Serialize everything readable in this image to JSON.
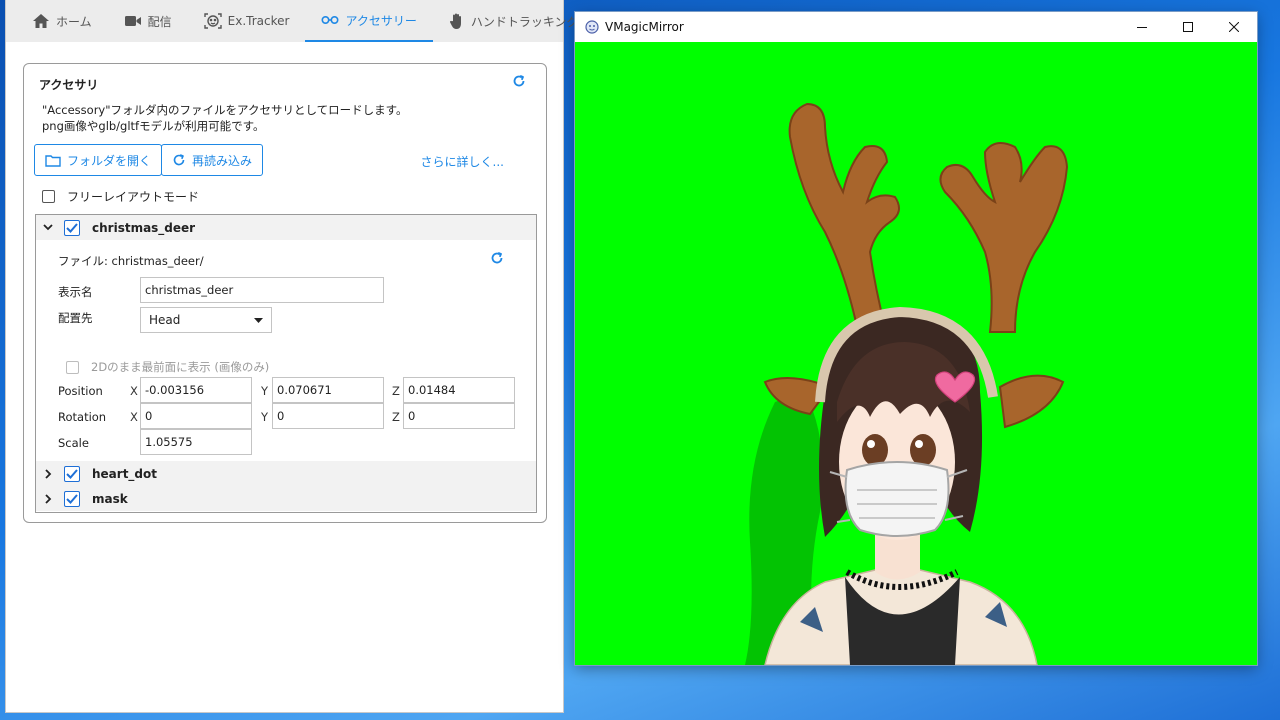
{
  "tabs": [
    {
      "label": "ホーム",
      "icon": "home-icon"
    },
    {
      "label": "配信",
      "icon": "video-camera-icon"
    },
    {
      "label": "Ex.Tracker",
      "icon": "face-tracking-icon"
    },
    {
      "label": "アクセサリー",
      "icon": "glasses-icon"
    },
    {
      "label": "ハンドトラッキング",
      "icon": "hand-icon"
    }
  ],
  "active_tab": "アクセサリー",
  "accessory": {
    "title": "アクセサリ",
    "desc_line1": "\"Accessory\"フォルダ内のファイルをアクセサリとしてロードします。",
    "desc_line2": "png画像やglb/gltfモデルが利用可能です。",
    "open_folder_label": "フォルダを開く",
    "reload_label": "再読み込み",
    "more_label": "さらに詳しく...",
    "free_layout_label": "フリーレイアウトモード",
    "free_layout_checked": false
  },
  "items": [
    {
      "name": "christmas_deer",
      "checked": true,
      "expanded": true
    },
    {
      "name": "heart_dot",
      "checked": true,
      "expanded": false
    },
    {
      "name": "mask",
      "checked": true,
      "expanded": false
    }
  ],
  "detail": {
    "file_text": "ファイル: christmas_deer/",
    "display_name_label": "表示名",
    "display_name_value": "christmas_deer",
    "attach_label": "配置先",
    "attach_value": "Head",
    "twod_label": "2Dのまま最前面に表示 (画像のみ)",
    "position_label": "Position",
    "rotation_label": "Rotation",
    "scale_label": "Scale",
    "axis_x": "X",
    "axis_y": "Y",
    "axis_z": "Z",
    "position": {
      "x": "-0.003156",
      "y": "0.070671",
      "z": "0.01484"
    },
    "rotation": {
      "x": "0",
      "y": "0",
      "z": "0"
    },
    "scale": "1.05575"
  },
  "viewer": {
    "title": "VMagicMirror",
    "background_color": "#00ff00"
  }
}
